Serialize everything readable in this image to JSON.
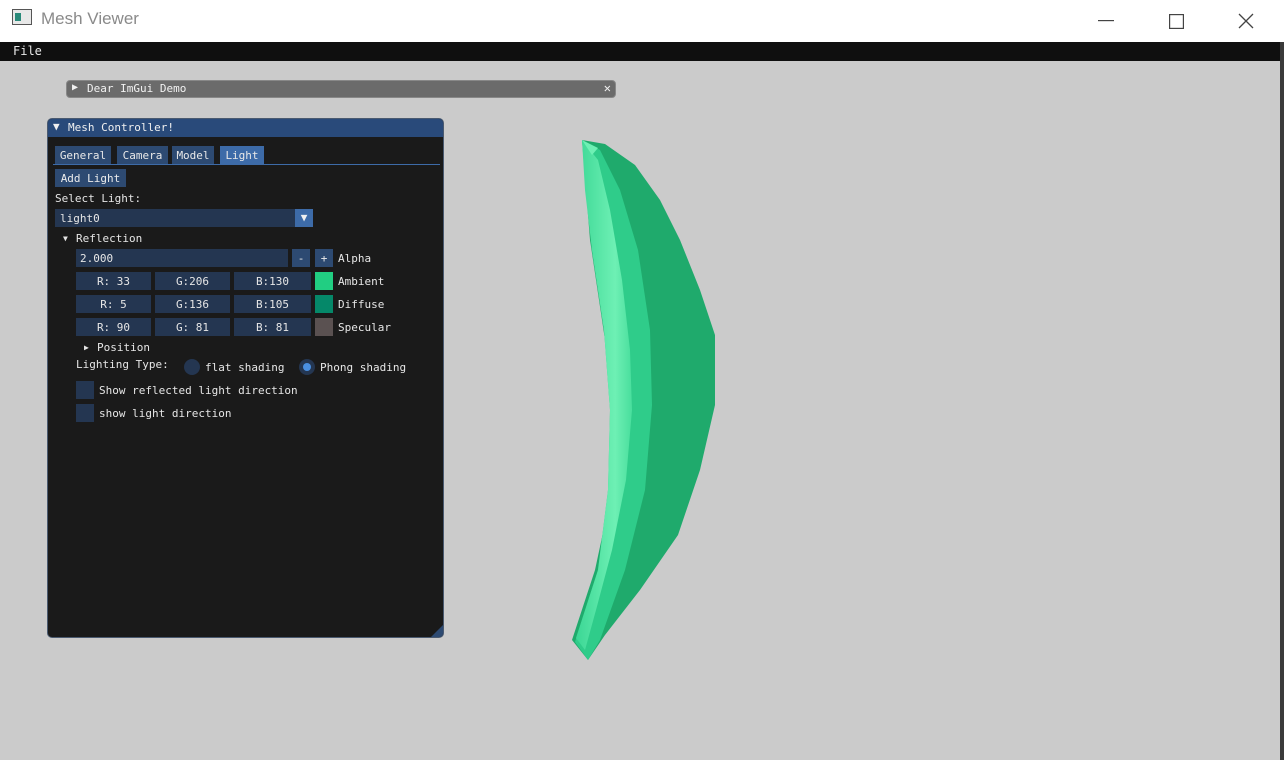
{
  "window": {
    "title": "Mesh Viewer",
    "minimize": "—",
    "maximize": "☐",
    "close": "✕"
  },
  "menu": {
    "file": "File"
  },
  "demo_window": {
    "arrow": "▶",
    "title": "Dear ImGui Demo",
    "close": "✕"
  },
  "panel": {
    "arrow": "▼",
    "title": "Mesh Controller!",
    "tabs": [
      "General",
      "Camera",
      "Model",
      "Light"
    ],
    "active_tab": "Light",
    "add_light": "Add Light",
    "select_light_label": "Select Light:",
    "selected_light": "light0",
    "combo_arrow": "▼",
    "reflection": {
      "arrow": "▼",
      "label": "Reflection",
      "alpha": {
        "value": "2.000",
        "minus": "-",
        "plus": "+",
        "label": "Alpha"
      },
      "ambient": {
        "r": "R: 33",
        "g": "G:206",
        "b": "B:130",
        "label": "Ambient",
        "color": "#21ce82"
      },
      "diffuse": {
        "r": "R:  5",
        "g": "G:136",
        "b": "B:105",
        "label": "Diffuse",
        "color": "#058869"
      },
      "specular": {
        "r": "R: 90",
        "g": "G: 81",
        "b": "B: 81",
        "label": "Specular",
        "color": "#5a5151"
      }
    },
    "position": {
      "arrow": "▶",
      "label": "Position"
    },
    "lighting_type": {
      "label": "Lighting Type:",
      "flat": "flat shading",
      "phong": "Phong shading",
      "selected": "phong"
    },
    "show_reflected": "Show reflected light direction",
    "show_light": "show light direction"
  },
  "mesh_colors": {
    "light": "#6ef0b4",
    "mid": "#2fcc8a",
    "dark": "#1faa6c"
  }
}
